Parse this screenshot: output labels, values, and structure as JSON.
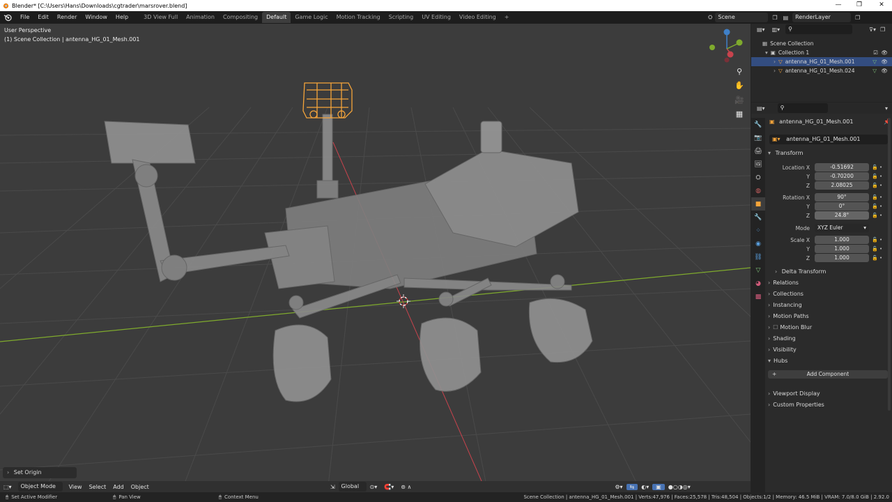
{
  "window": {
    "title": "Blender* [C:\\Users\\Hans\\Downloads\\cgtrader\\marsrover.blend]",
    "minimize": "—",
    "restore": "❐",
    "close": "✕"
  },
  "menu": [
    "File",
    "Edit",
    "Render",
    "Window",
    "Help"
  ],
  "workspaces": [
    {
      "label": "3D View Full",
      "active": false
    },
    {
      "label": "Animation",
      "active": false
    },
    {
      "label": "Compositing",
      "active": false
    },
    {
      "label": "Default",
      "active": true
    },
    {
      "label": "Game Logic",
      "active": false
    },
    {
      "label": "Motion Tracking",
      "active": false
    },
    {
      "label": "Scripting",
      "active": false
    },
    {
      "label": "UV Editing",
      "active": false
    },
    {
      "label": "Video Editing",
      "active": false
    }
  ],
  "add_workspace": "+",
  "scene": {
    "label": "Scene",
    "render_layer": "RenderLayer"
  },
  "viewport": {
    "perspective": "User Perspective",
    "collection_info": "(1) Scene Collection | antenna_HG_01_Mesh.001",
    "set_origin": "Set Origin",
    "gizmo": {
      "z": "Z",
      "y": "Y",
      "x": "X"
    }
  },
  "viewport_header": {
    "mode": "Object Mode",
    "menus": [
      "View",
      "Select",
      "Add",
      "Object"
    ],
    "orientation": "Global"
  },
  "status": {
    "left1": "Set Active Modifier",
    "left2": "Pan View",
    "left3": "Context Menu",
    "stats": "Scene Collection | antenna_HG_01_Mesh.001 | Verts:47,976 | Faces:25,578 | Tris:48,504 | Objects:1/2 | Memory: 46.5 MiB | VRAM: 7.0/8.0 GiB | 2.92.0"
  },
  "outliner": {
    "root": "Scene Collection",
    "collection": "Collection 1",
    "items": [
      {
        "label": "antenna_HG_01_Mesh.001",
        "selected": true
      },
      {
        "label": "antenna_HG_01_Mesh.024",
        "selected": false
      }
    ]
  },
  "properties": {
    "object_name": "antenna_HG_01_Mesh.001",
    "data_name": "antenna_HG_01_Mesh.001",
    "transform_label": "Transform",
    "location": {
      "label_x": "Location X",
      "label_y": "Y",
      "label_z": "Z",
      "x": "-0.51692",
      "y": "-0.70200",
      "z": "2.08025"
    },
    "rotation": {
      "label_x": "Rotation X",
      "label_y": "Y",
      "label_z": "Z",
      "x": "90°",
      "y": "0°",
      "z": "24.8°"
    },
    "mode": {
      "label": "Mode",
      "value": "XYZ Euler"
    },
    "scale": {
      "label_x": "Scale X",
      "label_y": "Y",
      "label_z": "Z",
      "x": "1.000",
      "y": "1.000",
      "z": "1.000"
    },
    "delta_transform": "Delta Transform",
    "panels": [
      "Relations",
      "Collections",
      "Instancing",
      "Motion Paths",
      "Motion Blur",
      "Shading",
      "Visibility",
      "Hubs"
    ],
    "add_component": "Add Component",
    "panels2": [
      "Viewport Display",
      "Custom Properties"
    ]
  },
  "colors": {
    "accent_blue": "#4772b3",
    "selection_orange": "#f5a43a",
    "x_axis": "#c8434d",
    "y_axis": "#7faa2d",
    "z_axis": "#3f80c8"
  }
}
